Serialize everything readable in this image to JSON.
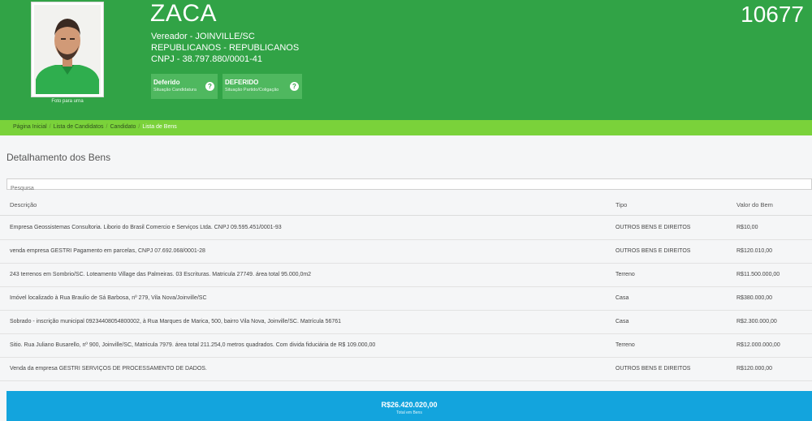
{
  "candidate": {
    "name": "ZACA",
    "number": "10677",
    "role": "Vereador - JOINVILLE/SC",
    "party": "REPUBLICANOS - REPUBLICANOS",
    "cnpj": "CNPJ - 38.797.880/0001-41",
    "photo_caption": "Foto para urna"
  },
  "status": [
    {
      "title": "Deferido",
      "subtitle": "Situação Candidatura"
    },
    {
      "title": "DEFERIDO",
      "subtitle": "Situação Partido/Coligação"
    }
  ],
  "breadcrumb": [
    "Página Inicial",
    "Lista de Candidatos",
    "Candidato",
    "Lista de Bens"
  ],
  "section_title": "Detalhamento dos Bens",
  "search": {
    "placeholder": "Pesquisa"
  },
  "table": {
    "headers": [
      "Descrição",
      "Tipo",
      "Valor do Bem"
    ],
    "rows": [
      [
        "Empresa Geossistemas Consultoria. Liborio do Brasil Comercio e Serviços Ltda. CNPJ 09.595.451/0001-93",
        "OUTROS BENS E DIREITOS",
        "R$10,00"
      ],
      [
        "venda empresa GESTRI Pagamento em parcelas, CNPJ 07.692.068/0001-28",
        "OUTROS BENS E DIREITOS",
        "R$120.010,00"
      ],
      [
        "243 terrenos em Sombrio/SC. Loteamento Village das Palmeiras. 03 Escrituras. Matricula 27749. área total 95.000,0m2",
        "Terreno",
        "R$11.500.000,00"
      ],
      [
        "Imóvel localizado à Rua Braulio de Sá Barbosa, nº 279, Vila Nova/Joinville/SC",
        "Casa",
        "R$380.000,00"
      ],
      [
        "Sobrado - inscrição municipal 09234408054800002, à Rua Marques de Marica, 500, bairro Vila Nova, Joinville/SC. Matrícula 56761",
        "Casa",
        "R$2.300.000,00"
      ],
      [
        "Sitio. Rua Juliano Busarello, nº 900, Joinville/SC, Matricula 7979. área total 211.254,0 metros quadrados. Com divida fiduciária de R$ 109.000,00",
        "Terreno",
        "R$12.000.000,00"
      ],
      [
        "Venda da empresa GESTRI SERVIÇOS DE PROCESSAMENTO DE DADOS.",
        "OUTROS BENS E DIREITOS",
        "R$120.000,00"
      ]
    ]
  },
  "total": {
    "value": "R$26.420.020,00",
    "label": "Total em Bens"
  },
  "colors": {
    "header_green": "#31a346",
    "breadcrumb_green": "#7ad23a",
    "total_blue": "#13a4dd"
  }
}
